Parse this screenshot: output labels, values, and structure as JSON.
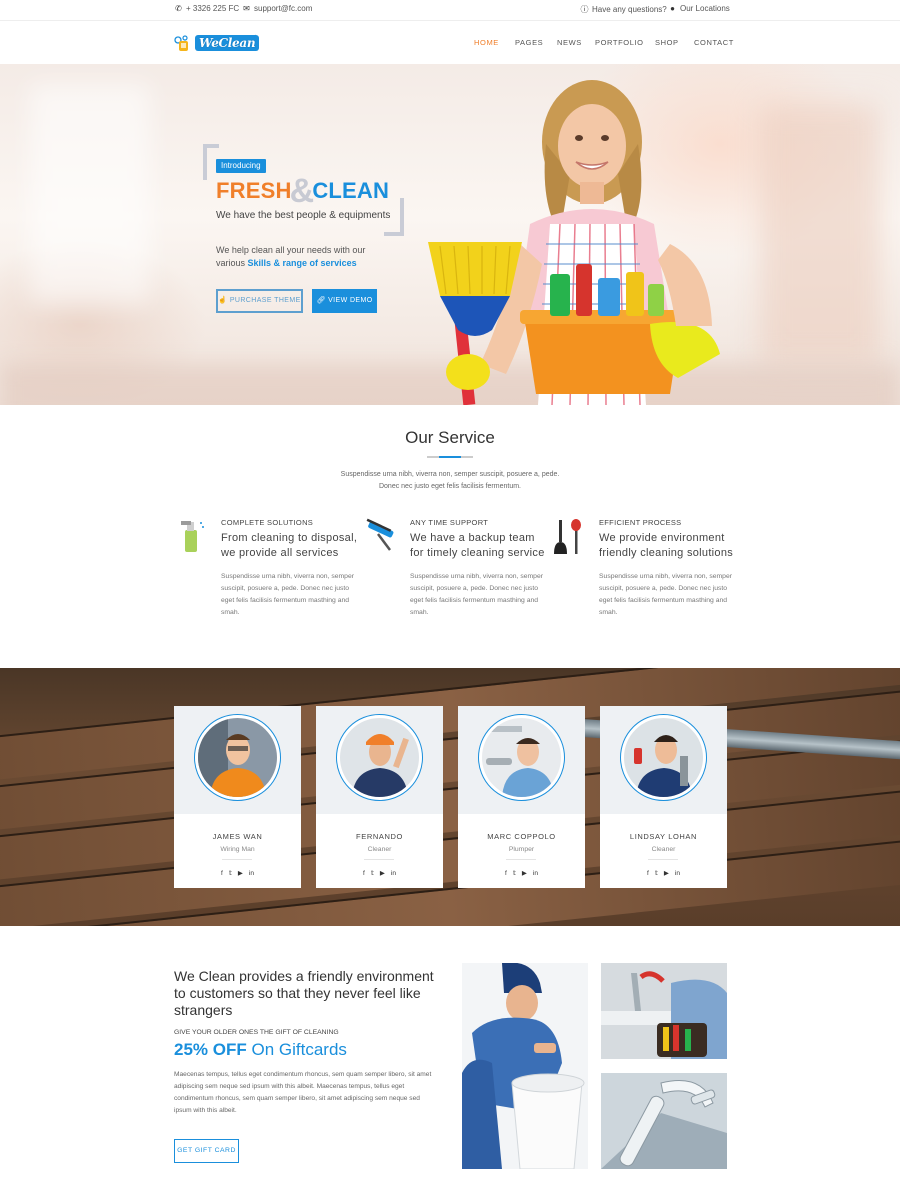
{
  "topbar": {
    "phone": "+ 3326 225 FC",
    "email": "support@fc.com",
    "questions": "Have any questions?",
    "locations": "Our Locations"
  },
  "nav": {
    "logo_text": "WeClean",
    "items": [
      "HOME",
      "PAGES",
      "NEWS",
      "PORTFOLIO",
      "SHOP",
      "CONTACT"
    ],
    "active": "HOME",
    "accent_color": "#f07f2a"
  },
  "hero": {
    "badge": "Introducing",
    "title_part1": "FRESH",
    "title_amp": "&",
    "title_part2": "CLEAN",
    "subtitle": "We have the best people & equipments",
    "text_line1": "We help clean all your needs with our",
    "text_prefix": "various",
    "text_highlight": "Skills & range of services",
    "btn_purchase": "PURCHASE THEME",
    "btn_demo": "VIEW DEMO"
  },
  "services": {
    "title": "Our Service",
    "desc_line1": "Suspendisse urna nibh, viverra non, semper suscipit, posuere a, pede.",
    "desc_line2": "Donec nec justo eget felis facilisis fermentum.",
    "items": [
      {
        "icon": "spray-bottle-icon",
        "caption": "COMPLETE SOLUTIONS",
        "heading": "From cleaning to disposal, we provide all services",
        "body": "Suspendisse urna nibh, viverra non, semper suscipit, posuere a, pede. Donec nec justo eget felis facilisis fermentum masthing and smah."
      },
      {
        "icon": "squeegee-icon",
        "caption": "ANY TIME SUPPORT",
        "heading": "We have a backup team for timely cleaning service",
        "body": "Suspendisse urna nibh, viverra non, semper suscipit, posuere a, pede. Donec nec justo eget felis facilisis fermentum masthing and smah."
      },
      {
        "icon": "plunger-icon",
        "caption": "EFFICIENT PROCESS",
        "heading": "We provide environment friendly cleaning solutions",
        "body": "Suspendisse urna nibh, viverra non, semper suscipit, posuere a, pede. Donec nec justo eget felis facilisis fermentum masthing and smah."
      }
    ]
  },
  "team": [
    {
      "name": "JAMES WAN",
      "role": "Wiring Man"
    },
    {
      "name": "FERNANDO",
      "role": "Cleaner"
    },
    {
      "name": "MARC COPPOLO",
      "role": "Plumper"
    },
    {
      "name": "LINDSAY LOHAN",
      "role": "Cleaner"
    }
  ],
  "social_icons": [
    "f",
    "𝕥",
    "▶",
    "in"
  ],
  "gift": {
    "heading": "We Clean provides a friendly environment to customers so that they never feel like strangers",
    "caption": "GIVE YOUR OLDER ONES THE GIFT OF CLEANING",
    "offer_bold": "25% OFF",
    "offer_rest": "On Giftcards",
    "body": "Maecenas tempus, tellus eget condimentum rhoncus, sem quam semper libero, sit amet adipiscing sem neque sed ipsum with this albeit. Maecenas tempus, tellus eget condimentum rhoncus, sem quam semper libero, sit amet adipiscing sem neque sed ipsum with this albeit.",
    "button": "GET GIFT CARD"
  },
  "colors": {
    "brand_blue": "#1a8fdc",
    "brand_orange": "#f07f2a"
  }
}
